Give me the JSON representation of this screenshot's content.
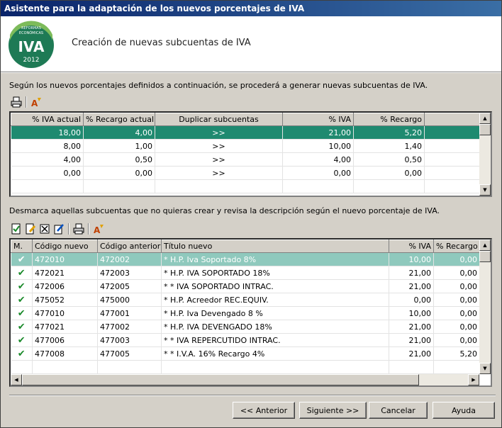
{
  "window": {
    "title": "Asistente para la adaptación de los nuevos porcentajes de IVA"
  },
  "header": {
    "title": "Creación de nuevas subcuentas de IVA",
    "logo": {
      "line1": "REFORMAS",
      "line2": "ECONÓMICAS",
      "line3": "IVA",
      "line4": "2012"
    }
  },
  "section1": {
    "description": "Según los nuevos porcentajes definidos a continuación, se procederá a generar nuevas subcuentas  de IVA.",
    "toolbar": [
      "print-icon",
      "format-icon"
    ],
    "columns": [
      "% IVA actual",
      "% Recargo actual",
      "Duplicar subcuentas",
      "% IVA",
      "% Recargo",
      ""
    ],
    "rows": [
      [
        "18,00",
        "4,00",
        ">>",
        "21,00",
        "5,20",
        ""
      ],
      [
        "8,00",
        "1,00",
        ">>",
        "10,00",
        "1,40",
        ""
      ],
      [
        "4,00",
        "0,50",
        ">>",
        "4,00",
        "0,50",
        ""
      ],
      [
        "0,00",
        "0,00",
        ">>",
        "0,00",
        "0,00",
        ""
      ],
      [
        "",
        "",
        "",
        "",
        "",
        ""
      ]
    ]
  },
  "section2": {
    "description": "Desmarca aquellas subcuentas que no quieras crear y revisa la descripción según el nuevo porcentaje de IVA.",
    "toolbar": [
      "check-all-icon",
      "edit-icon",
      "uncheck-icon",
      "edit-description-icon",
      "print-icon",
      "format-icon"
    ],
    "columns": [
      "M.",
      "Código nuevo",
      "Código anterior",
      "Título nuevo",
      "% IVA",
      "% Recargo"
    ],
    "rows": [
      [
        "✔",
        "472010",
        "472002",
        "*  H.P. Iva Soportado 8%",
        "10,00",
        "0,00"
      ],
      [
        "✔",
        "472021",
        "472003",
        "* H.P. IVA SOPORTADO 18%",
        "21,00",
        "0,00"
      ],
      [
        "✔",
        "472006",
        "472005",
        "* * IVA SOPORTADO INTRAC.",
        "21,00",
        "0,00"
      ],
      [
        "✔",
        "475052",
        "475000",
        "* H.P. Acreedor REC.EQUIV.",
        "0,00",
        "0,00"
      ],
      [
        "✔",
        "477010",
        "477001",
        "* H.P. Iva Devengado 8 %",
        "10,00",
        "0,00"
      ],
      [
        "✔",
        "477021",
        "477002",
        "* H.P. IVA DEVENGADO 18%",
        "21,00",
        "0,00"
      ],
      [
        "✔",
        "477006",
        "477003",
        "* * IVA REPERCUTIDO INTRAC.",
        "21,00",
        "0,00"
      ],
      [
        "✔",
        "477008",
        "477005",
        "* * I.V.A. 16% Recargo 4%",
        "21,00",
        "5,20"
      ],
      [
        "",
        "",
        "",
        "",
        "",
        ""
      ]
    ]
  },
  "buttons": {
    "back": "<< Anterior",
    "next": "Siguiente >>",
    "cancel": "Cancelar",
    "help": "Ayuda"
  },
  "colors": {
    "selected_row": "#1f8a70",
    "selected_row_light": "#8fc9bd",
    "titlebar": "#0a246a",
    "check": "#1a8a2a"
  }
}
